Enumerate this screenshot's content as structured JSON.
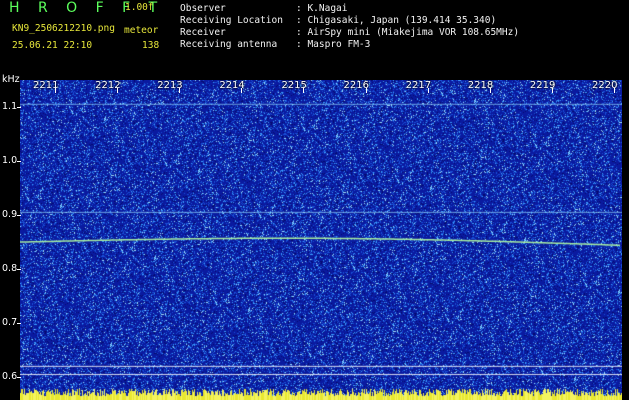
{
  "header": {
    "program_title": "H R O F F T",
    "version": "1.00f",
    "filename": "KN9_2506212210.png",
    "mode": "meteor",
    "datetime": "25.06.21 22:10",
    "count": "138",
    "fields": [
      {
        "label": "Observer",
        "value": ": K.Nagai"
      },
      {
        "label": "Receiving Location",
        "value": ": Chigasaki, Japan (139.414 35.340)"
      },
      {
        "label": "Receiver",
        "value": ": AirSpy mini (Miakejima VOR 108.65MHz)"
      },
      {
        "label": "Receiving antenna",
        "value": ": Maspro FM-3"
      }
    ]
  },
  "chart_data": {
    "type": "heatmap",
    "ylabel": "kHz",
    "yticks": [
      "1.1",
      "1.0",
      "0.9",
      "0.8",
      "0.7",
      "0.6"
    ],
    "xticks": [
      "2211",
      "2212",
      "2213",
      "2214",
      "2215",
      "2216",
      "2217",
      "2218",
      "2219",
      "2220"
    ],
    "ylim": [
      0.58,
      1.15
    ],
    "lines_khz": [
      1.105,
      0.905,
      0.85,
      0.62,
      0.605
    ]
  },
  "colors": {
    "background": "#000000",
    "spectrum_bg": "#0b1aa8",
    "noise_light": "#3aa0ff",
    "signal": "#a8f0a0"
  }
}
